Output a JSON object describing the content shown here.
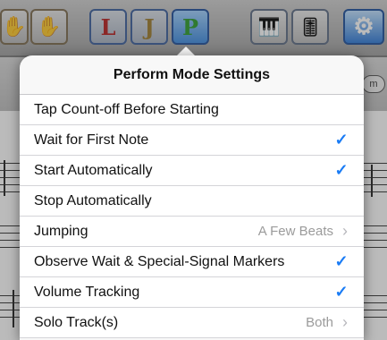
{
  "popover": {
    "title": "Perform Mode Settings",
    "rows": [
      {
        "label": "Tap Count-off Before Starting",
        "type": "toggle",
        "checked": false
      },
      {
        "label": "Wait for First Note",
        "type": "toggle",
        "checked": true
      },
      {
        "label": "Start Automatically",
        "type": "toggle",
        "checked": true
      },
      {
        "label": "Stop Automatically",
        "type": "toggle",
        "checked": false
      },
      {
        "label": "Jumping",
        "type": "disclosure",
        "value": "A Few Beats"
      },
      {
        "label": "Observe Wait & Special-Signal Markers",
        "type": "toggle",
        "checked": true
      },
      {
        "label": "Volume Tracking",
        "type": "toggle",
        "checked": true
      },
      {
        "label": "Solo Track(s)",
        "type": "disclosure",
        "value": "Both"
      }
    ],
    "checkmark_glyph": "✓",
    "chevron_glyph": "›"
  },
  "toolbar": {
    "letter_l": "L",
    "letter_j": "J",
    "letter_p": "P",
    "hand_glyph": "✋",
    "gear_glyph": "⚙",
    "piano_glyph": "🎹",
    "mixer_glyph": "🎚"
  },
  "subbar": {
    "pill_text": "m"
  },
  "colors": {
    "accent": "#1a7cf5",
    "detail_text": "#9b9b9b",
    "separator": "#d4d4d8"
  }
}
